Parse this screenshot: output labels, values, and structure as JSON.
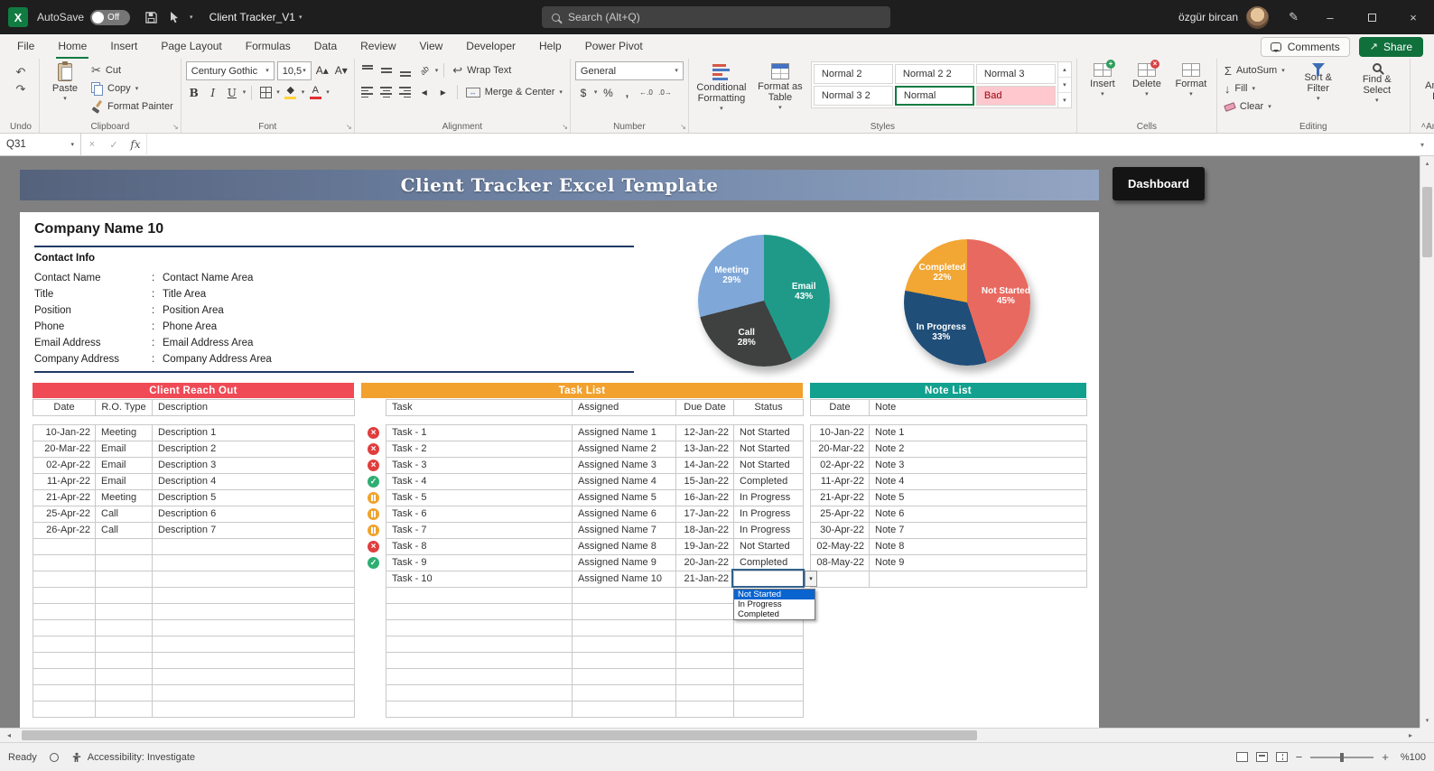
{
  "title_bar": {
    "autosave_label": "AutoSave",
    "autosave_state": "Off",
    "file_name": "Client Tracker_V1",
    "search_placeholder": "Search (Alt+Q)",
    "user_name": "özgür bircan"
  },
  "ribbon": {
    "tabs": [
      {
        "label": "File"
      },
      {
        "label": "Home",
        "active": true
      },
      {
        "label": "Insert"
      },
      {
        "label": "Page Layout"
      },
      {
        "label": "Formulas"
      },
      {
        "label": "Data"
      },
      {
        "label": "Review"
      },
      {
        "label": "View"
      },
      {
        "label": "Developer"
      },
      {
        "label": "Help"
      },
      {
        "label": "Power Pivot"
      }
    ],
    "comments_label": "Comments",
    "share_label": "Share",
    "groups": {
      "undo": {
        "label": "Undo"
      },
      "clipboard": {
        "label": "Clipboard",
        "paste": "Paste",
        "cut": "Cut",
        "copy": "Copy",
        "format_painter": "Format Painter"
      },
      "font": {
        "label": "Font",
        "family": "Century Gothic",
        "size": "10,5"
      },
      "alignment": {
        "label": "Alignment",
        "wrap_text": "Wrap Text",
        "merge_center": "Merge & Center"
      },
      "number": {
        "label": "Number",
        "format": "General"
      },
      "styles": {
        "label": "Styles",
        "conditional_formatting": "Conditional Formatting",
        "format_as_table": "Format as Table",
        "cell_styles": [
          "Normal 2",
          "Normal 2 2",
          "Normal 3",
          "Normal 3 2",
          "Normal",
          "Bad"
        ],
        "selected_style": "Normal"
      },
      "cells": {
        "label": "Cells",
        "insert": "Insert",
        "delete": "Delete",
        "format": "Format"
      },
      "editing": {
        "label": "Editing",
        "autosum": "AutoSum",
        "fill": "Fill",
        "clear": "Clear",
        "sort_filter": "Sort & Filter",
        "find_select": "Find & Select"
      },
      "analysis": {
        "label": "Analysis",
        "analyze_data": "Analyze Data"
      }
    }
  },
  "formula_bar": {
    "name_box": "Q31",
    "fx_label": "fx"
  },
  "sheet": {
    "banner_title": "Client Tracker Excel Template",
    "dashboard_button": "Dashboard",
    "company_name": "Company Name 10",
    "contact_heading": "Contact Info",
    "separator": ":",
    "contact_fields": [
      {
        "label": "Contact Name",
        "value": "Contact Name Area"
      },
      {
        "label": "Title",
        "value": "Title Area"
      },
      {
        "label": "Position",
        "value": "Position Area"
      },
      {
        "label": "Phone",
        "value": "Phone Area"
      },
      {
        "label": "Email Address",
        "value": "Email Address Area"
      },
      {
        "label": "Company Address",
        "value": "Company Address Area"
      }
    ],
    "tables": {
      "reach_out": {
        "title": "Client Reach Out",
        "accent": "#ef4a56",
        "headers": [
          "Date",
          "R.O. Type",
          "Description"
        ],
        "rows": [
          [
            "10-Jan-22",
            "Meeting",
            "Description 1"
          ],
          [
            "20-Mar-22",
            "Email",
            "Description 2"
          ],
          [
            "02-Apr-22",
            "Email",
            "Description 3"
          ],
          [
            "11-Apr-22",
            "Email",
            "Description 4"
          ],
          [
            "21-Apr-22",
            "Meeting",
            "Description 5"
          ],
          [
            "25-Apr-22",
            "Call",
            "Description 6"
          ],
          [
            "26-Apr-22",
            "Call",
            "Description 7"
          ]
        ],
        "empty_rows": 11
      },
      "tasks": {
        "title": "Task List",
        "accent": "#f2a12f",
        "headers": [
          "Task",
          "Assigned",
          "Due Date",
          "Status"
        ],
        "rows": [
          {
            "task": "Task - 1",
            "assigned": "Assigned Name 1",
            "due": "12-Jan-22",
            "status": "Not Started",
            "state": "not-started"
          },
          {
            "task": "Task - 2",
            "assigned": "Assigned Name 2",
            "due": "13-Jan-22",
            "status": "Not Started",
            "state": "not-started"
          },
          {
            "task": "Task - 3",
            "assigned": "Assigned Name 3",
            "due": "14-Jan-22",
            "status": "Not Started",
            "state": "not-started"
          },
          {
            "task": "Task - 4",
            "assigned": "Assigned Name 4",
            "due": "15-Jan-22",
            "status": "Completed",
            "state": "completed"
          },
          {
            "task": "Task - 5",
            "assigned": "Assigned Name 5",
            "due": "16-Jan-22",
            "status": "In Progress",
            "state": "in-progress"
          },
          {
            "task": "Task - 6",
            "assigned": "Assigned Name 6",
            "due": "17-Jan-22",
            "status": "In Progress",
            "state": "in-progress"
          },
          {
            "task": "Task - 7",
            "assigned": "Assigned Name 7",
            "due": "18-Jan-22",
            "status": "In Progress",
            "state": "in-progress"
          },
          {
            "task": "Task - 8",
            "assigned": "Assigned Name 8",
            "due": "19-Jan-22",
            "status": "Not Started",
            "state": "not-started"
          },
          {
            "task": "Task - 9",
            "assigned": "Assigned Name 9",
            "due": "20-Jan-22",
            "status": "Completed",
            "state": "completed"
          },
          {
            "task": "Task - 10",
            "assigned": "Assigned Name 10",
            "due": "21-Jan-22",
            "status": "",
            "state": ""
          }
        ],
        "empty_rows": 8
      },
      "notes": {
        "title": "Note List",
        "accent": "#12a18f",
        "headers": [
          "Date",
          "Note"
        ],
        "rows": [
          [
            "10-Jan-22",
            "Note 1"
          ],
          [
            "20-Mar-22",
            "Note 2"
          ],
          [
            "02-Apr-22",
            "Note 3"
          ],
          [
            "11-Apr-22",
            "Note 4"
          ],
          [
            "21-Apr-22",
            "Note 5"
          ],
          [
            "25-Apr-22",
            "Note 6"
          ],
          [
            "30-Apr-22",
            "Note 7"
          ],
          [
            "02-May-22",
            "Note 8"
          ],
          [
            "08-May-22",
            "Note 9"
          ]
        ],
        "empty_rows": 1
      }
    },
    "status_dropdown": {
      "options": [
        "Not Started",
        "In Progress",
        "Completed"
      ],
      "highlighted": "Not Started"
    }
  },
  "chart_data": [
    {
      "type": "pie",
      "labels": [
        "Email",
        "Call",
        "Meeting"
      ],
      "values": [
        43,
        28,
        29
      ],
      "colors": [
        "#1f9a89",
        "#3f4040",
        "#7fa8d9"
      ],
      "legend_position": "none",
      "data_labels": "name+percent"
    },
    {
      "type": "pie",
      "labels": [
        "Not Started",
        "In Progress",
        "Completed"
      ],
      "values": [
        45,
        33,
        22
      ],
      "colors": [
        "#e8695f",
        "#1f4e79",
        "#f2a634"
      ],
      "legend_position": "none",
      "data_labels": "name+percent"
    }
  ],
  "status_bar": {
    "ready": "Ready",
    "accessibility": "Accessibility: Investigate",
    "zoom": "%100"
  }
}
